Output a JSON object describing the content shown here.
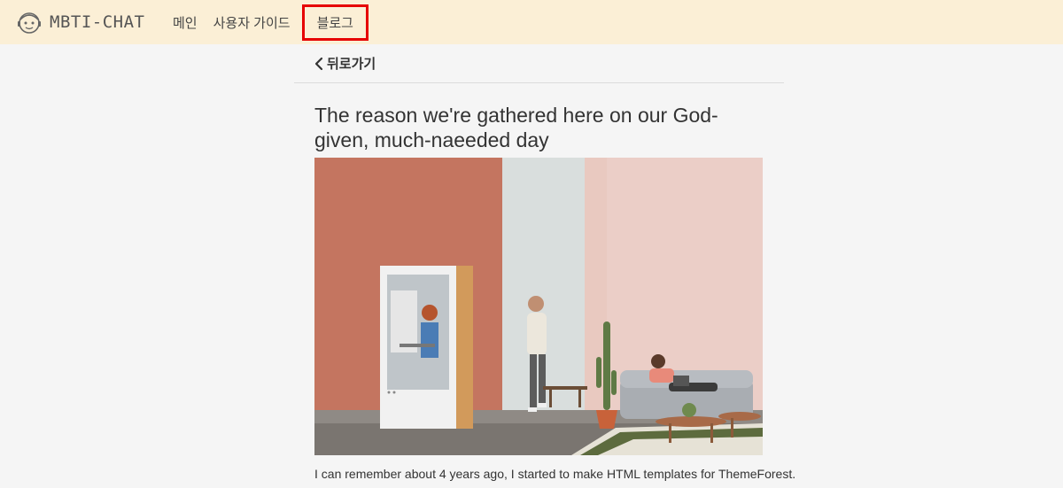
{
  "header": {
    "brand": "MBTI-CHAT",
    "brand_icon": "mascot-icon",
    "nav": [
      {
        "label": "메인"
      },
      {
        "label": "사용자 가이드"
      },
      {
        "label": "블로그"
      }
    ],
    "highlight_color": "#e60000"
  },
  "back": {
    "label": "뒤로가기",
    "icon": "chevron-left-icon"
  },
  "post": {
    "title": "The reason we're gathered here on our God-given, much-naeeded day",
    "excerpt": "I can remember about 4 years ago, I started to make HTML templates for ThemeForest."
  },
  "colors": {
    "header_bg": "#fbefd6",
    "page_bg": "#f5f5f5"
  }
}
